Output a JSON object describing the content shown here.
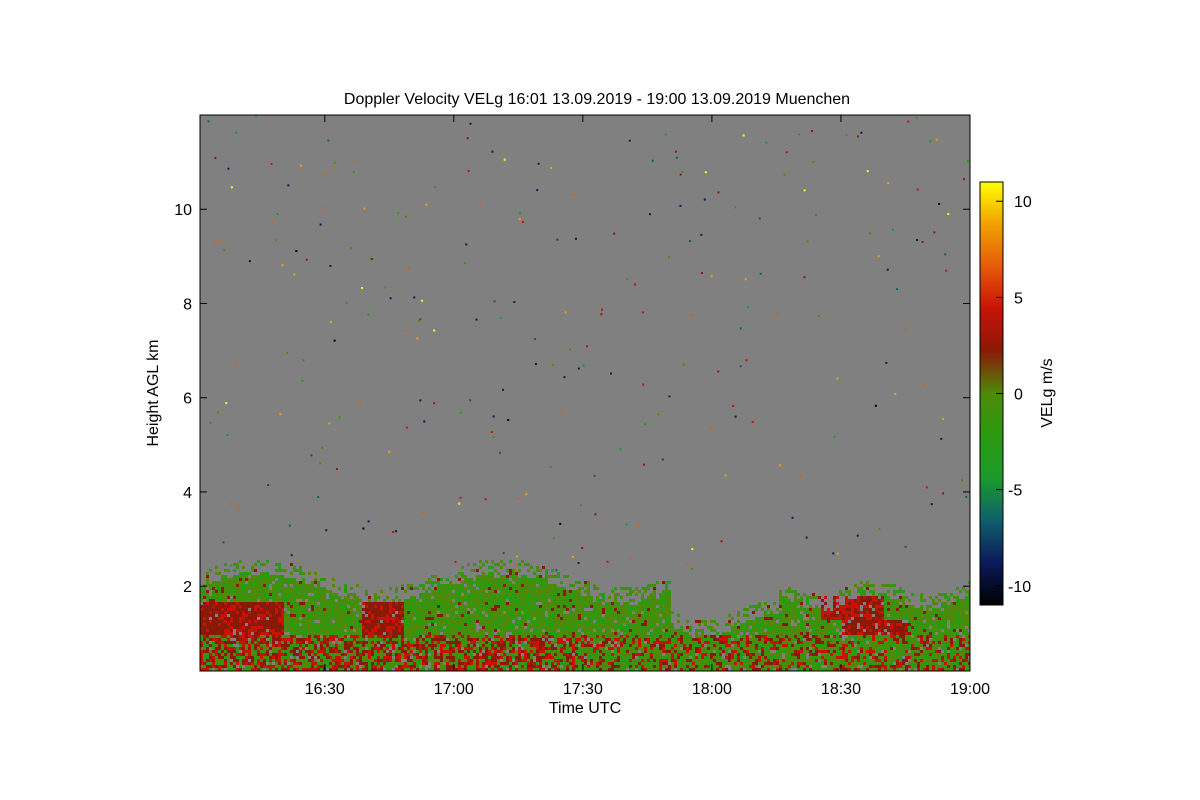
{
  "chart_data": {
    "type": "heatmap",
    "title": "Doppler Velocity VELg   16:01 13.09.2019 - 19:00 13.09.2019 Muenchen",
    "xlabel": "Time UTC",
    "ylabel": "Height AGL km",
    "colorbar_label": "VELg m/s",
    "x_ticks": [
      "16:30",
      "17:00",
      "17:30",
      "18:00",
      "18:30",
      "19:00"
    ],
    "x_tick_minutes": [
      30,
      60,
      90,
      120,
      150,
      180
    ],
    "xlim_minutes": [
      1,
      180
    ],
    "y_ticks": [
      2,
      4,
      6,
      8,
      10
    ],
    "ylim": [
      0.2,
      12.0
    ],
    "colorbar_ticks": [
      10,
      5,
      0,
      -5,
      -10
    ],
    "clim": [
      -11,
      11
    ],
    "no_data_color": "#808080",
    "colormap": [
      "#000000",
      "#0b1a5a",
      "#0f5f6a",
      "#1b9a2a",
      "#2a9a10",
      "#4e8a0a",
      "#8a1a08",
      "#c81208",
      "#e65a0a",
      "#f0a000",
      "#ffff00"
    ],
    "signal_layers": [
      {
        "t_start": 1,
        "t_end": 180,
        "h_top": 1.0,
        "dominant": "green / red mixed near-surface echoes"
      },
      {
        "t_start": 1,
        "t_end": 110,
        "h_top": 2.3,
        "dominant": "green-olive boundary layer"
      },
      {
        "t_start": 135,
        "t_end": 180,
        "h_top": 1.8,
        "dominant": "olive / orange patches"
      }
    ]
  }
}
